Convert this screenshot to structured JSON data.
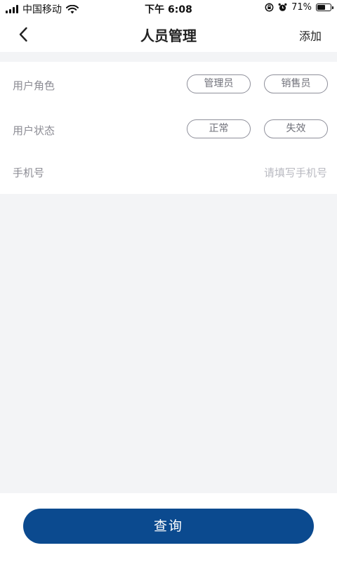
{
  "status_bar": {
    "carrier": "中国移动",
    "time": "下午 6:08",
    "battery_percent": "71%",
    "battery_level": 0.71
  },
  "nav": {
    "title": "人员管理",
    "add_label": "添加"
  },
  "filters": {
    "role": {
      "label": "用户角色",
      "options": [
        "管理员",
        "销售员"
      ]
    },
    "status": {
      "label": "用户状态",
      "options": [
        "正常",
        "失效"
      ]
    },
    "phone": {
      "label": "手机号",
      "placeholder": "请填写手机号",
      "value": ""
    }
  },
  "actions": {
    "query_label": "查询"
  },
  "colors": {
    "primary": "#0b4a8f",
    "background": "#f3f4f6",
    "label_gray": "#8c8c94",
    "chip_border": "#8e8f9a"
  }
}
